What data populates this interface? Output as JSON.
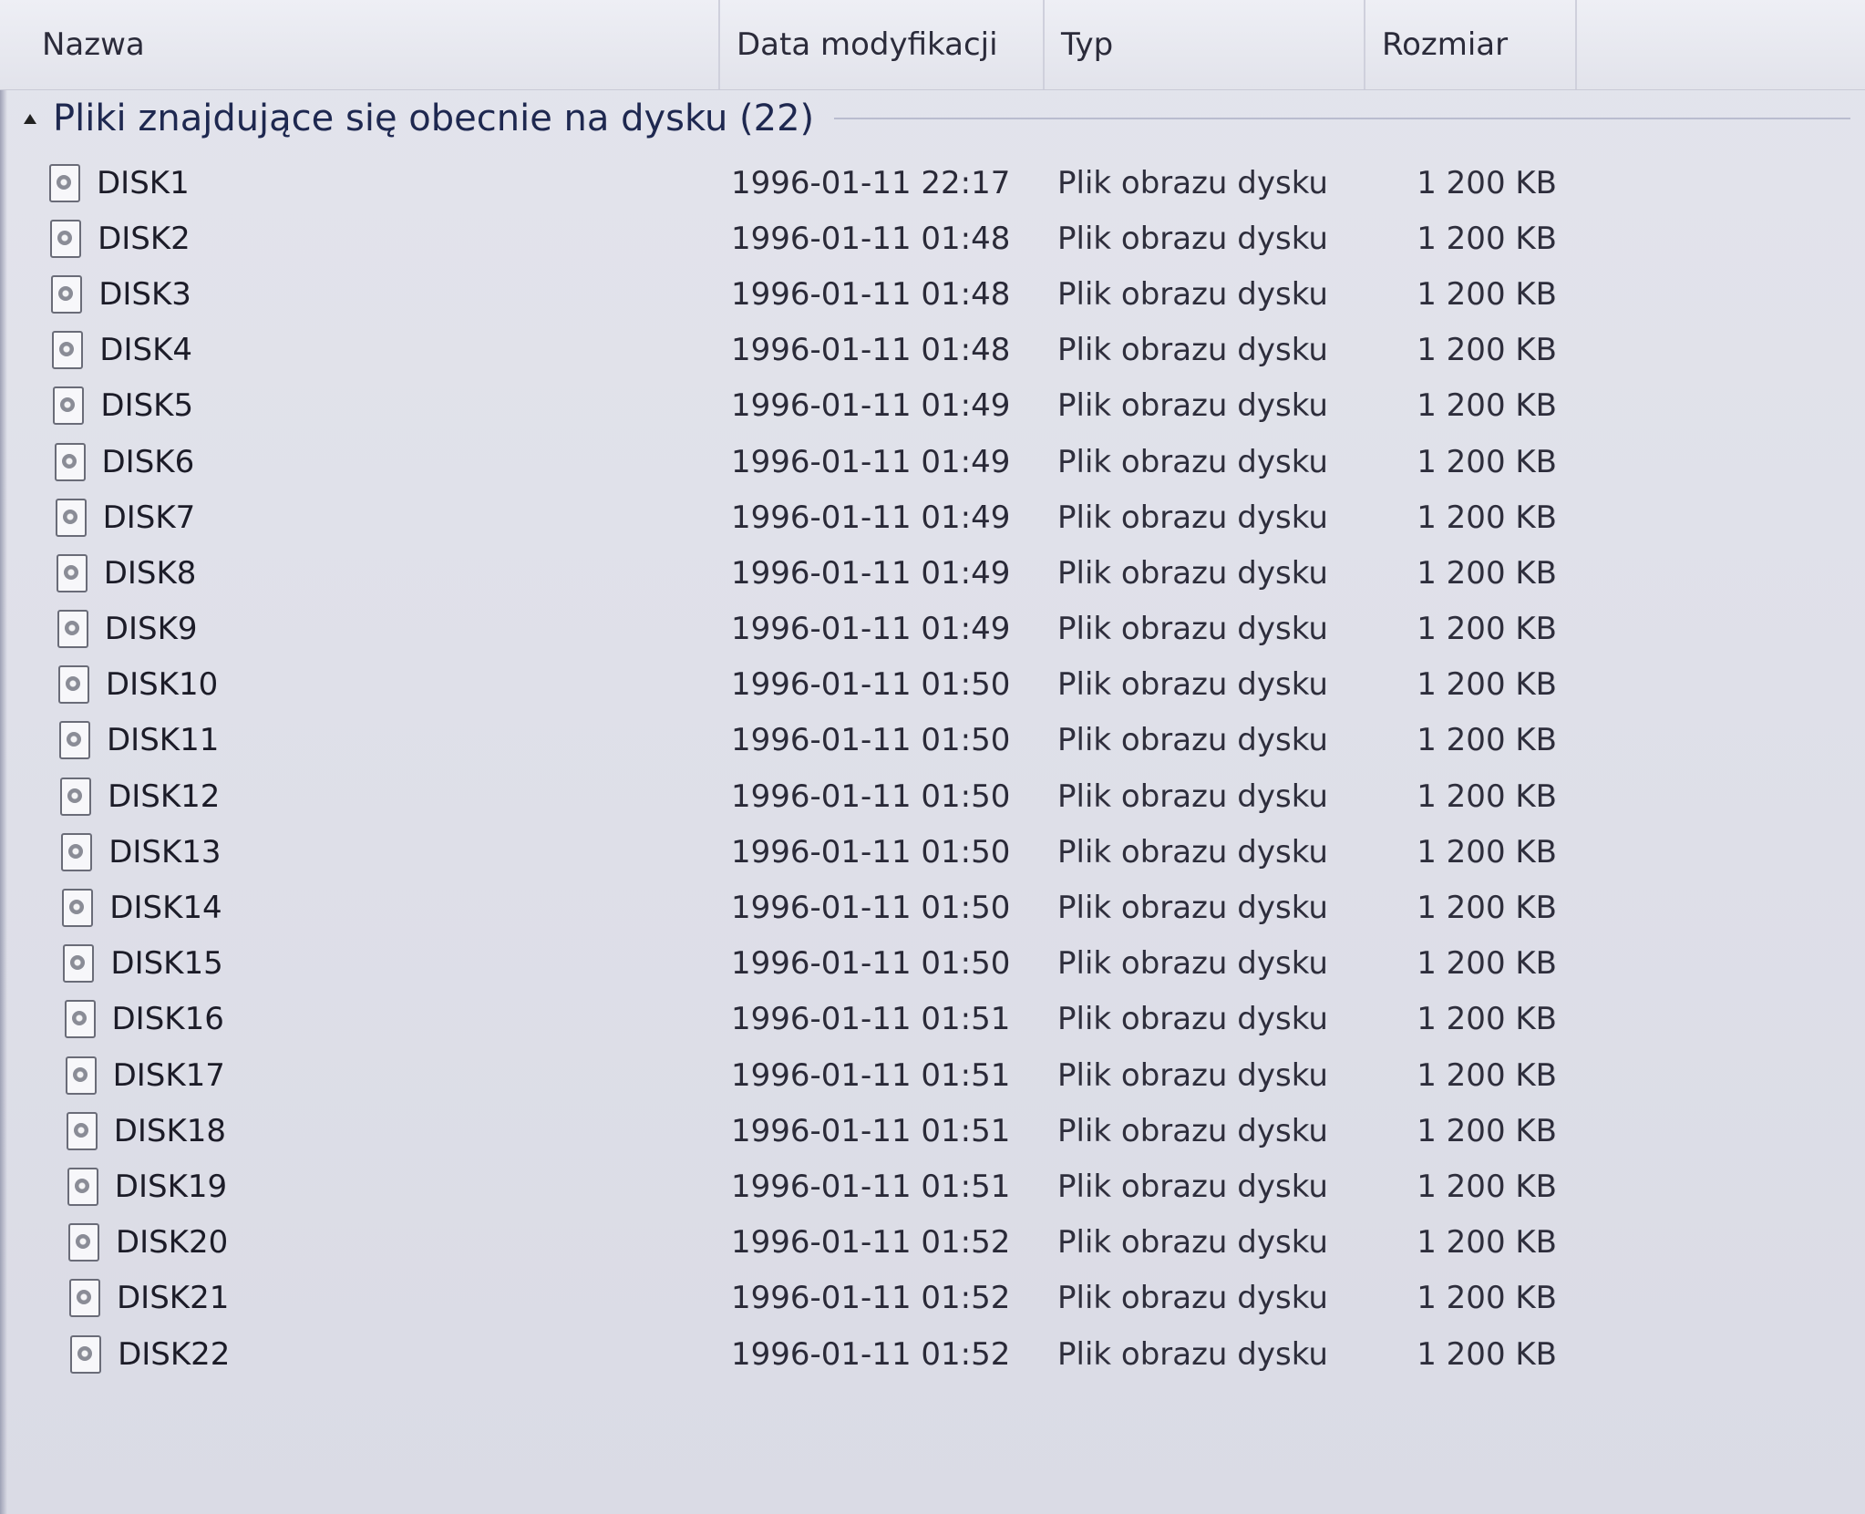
{
  "columns": {
    "name": "Nazwa",
    "date": "Data modyfikacji",
    "type": "Typ",
    "size": "Rozmiar"
  },
  "group": {
    "title": "Pliki znajdujące się obecnie na dysku (22)"
  },
  "icons": {
    "file": "disk-image-file-icon",
    "collapse": "collapse-triangle-icon"
  },
  "files": [
    {
      "name": "DISK1",
      "date": "1996-01-11 22:17",
      "type": "Plik obrazu dysku",
      "size": "1 200 KB"
    },
    {
      "name": "DISK2",
      "date": "1996-01-11 01:48",
      "type": "Plik obrazu dysku",
      "size": "1 200 KB"
    },
    {
      "name": "DISK3",
      "date": "1996-01-11 01:48",
      "type": "Plik obrazu dysku",
      "size": "1 200 KB"
    },
    {
      "name": "DISK4",
      "date": "1996-01-11 01:48",
      "type": "Plik obrazu dysku",
      "size": "1 200 KB"
    },
    {
      "name": "DISK5",
      "date": "1996-01-11 01:49",
      "type": "Plik obrazu dysku",
      "size": "1 200 KB"
    },
    {
      "name": "DISK6",
      "date": "1996-01-11 01:49",
      "type": "Plik obrazu dysku",
      "size": "1 200 KB"
    },
    {
      "name": "DISK7",
      "date": "1996-01-11 01:49",
      "type": "Plik obrazu dysku",
      "size": "1 200 KB"
    },
    {
      "name": "DISK8",
      "date": "1996-01-11 01:49",
      "type": "Plik obrazu dysku",
      "size": "1 200 KB"
    },
    {
      "name": "DISK9",
      "date": "1996-01-11 01:49",
      "type": "Plik obrazu dysku",
      "size": "1 200 KB"
    },
    {
      "name": "DISK10",
      "date": "1996-01-11 01:50",
      "type": "Plik obrazu dysku",
      "size": "1 200 KB"
    },
    {
      "name": "DISK11",
      "date": "1996-01-11 01:50",
      "type": "Plik obrazu dysku",
      "size": "1 200 KB"
    },
    {
      "name": "DISK12",
      "date": "1996-01-11 01:50",
      "type": "Plik obrazu dysku",
      "size": "1 200 KB"
    },
    {
      "name": "DISK13",
      "date": "1996-01-11 01:50",
      "type": "Plik obrazu dysku",
      "size": "1 200 KB"
    },
    {
      "name": "DISK14",
      "date": "1996-01-11 01:50",
      "type": "Plik obrazu dysku",
      "size": "1 200 KB"
    },
    {
      "name": "DISK15",
      "date": "1996-01-11 01:50",
      "type": "Plik obrazu dysku",
      "size": "1 200 KB"
    },
    {
      "name": "DISK16",
      "date": "1996-01-11 01:51",
      "type": "Plik obrazu dysku",
      "size": "1 200 KB"
    },
    {
      "name": "DISK17",
      "date": "1996-01-11 01:51",
      "type": "Plik obrazu dysku",
      "size": "1 200 KB"
    },
    {
      "name": "DISK18",
      "date": "1996-01-11 01:51",
      "type": "Plik obrazu dysku",
      "size": "1 200 KB"
    },
    {
      "name": "DISK19",
      "date": "1996-01-11 01:51",
      "type": "Plik obrazu dysku",
      "size": "1 200 KB"
    },
    {
      "name": "DISK20",
      "date": "1996-01-11 01:52",
      "type": "Plik obrazu dysku",
      "size": "1 200 KB"
    },
    {
      "name": "DISK21",
      "date": "1996-01-11 01:52",
      "type": "Plik obrazu dysku",
      "size": "1 200 KB"
    },
    {
      "name": "DISK22",
      "date": "1996-01-11 01:52",
      "type": "Plik obrazu dysku",
      "size": "1 200 KB"
    }
  ]
}
